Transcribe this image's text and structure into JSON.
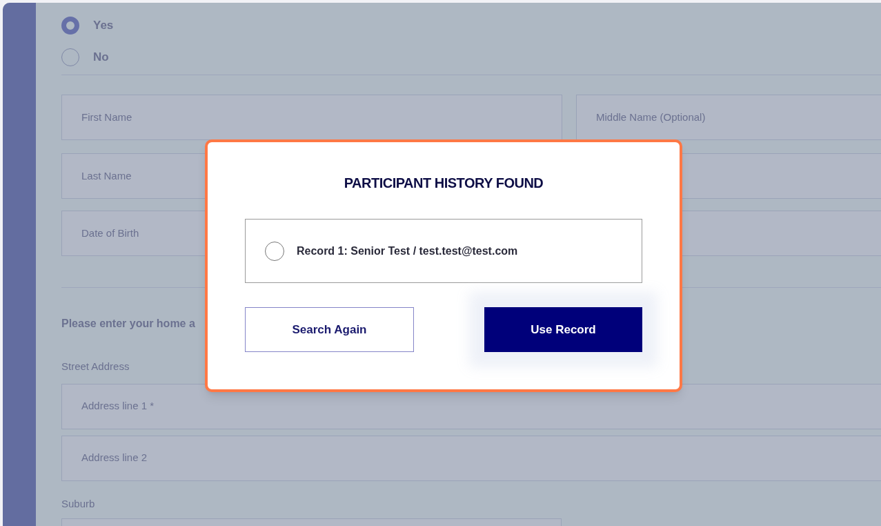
{
  "form": {
    "radio_options": [
      {
        "label": "Yes",
        "selected": true
      },
      {
        "label": "No",
        "selected": false
      }
    ],
    "name_fields": [
      {
        "placeholder": "First Name"
      },
      {
        "placeholder": "Middle Name (Optional)"
      },
      {
        "placeholder": "Last Name"
      },
      {
        "placeholder": "Date of Birth"
      }
    ],
    "address_prompt": "Please enter your home a",
    "street_label": "Street Address",
    "address_fields": [
      {
        "placeholder": "Address line 1 *"
      },
      {
        "placeholder": "Address line 2"
      }
    ],
    "suburb_label": "Suburb"
  },
  "dialog": {
    "title": "PARTICIPANT HISTORY FOUND",
    "records": [
      {
        "label": "Record 1: Senior Test / test.test@test.com",
        "selected": false
      }
    ],
    "buttons": [
      {
        "label": "Search Again",
        "kind": "secondary"
      },
      {
        "label": "Use Record",
        "kind": "primary"
      }
    ]
  }
}
